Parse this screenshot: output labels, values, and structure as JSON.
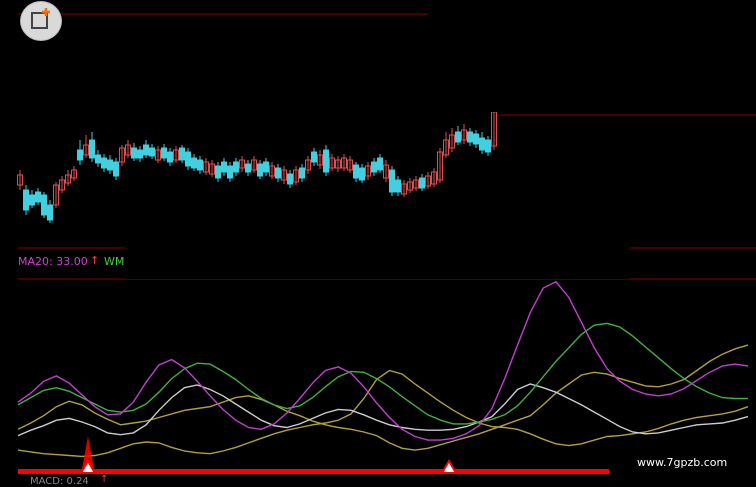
{
  "indicator_labels": {
    "ma20": "MA20: 33.00",
    "ma20_arrow": "↑",
    "next_series": "WM",
    "macd": "MACD: 0.24",
    "macd_arrow": "↑"
  },
  "watermark": "www.7gpzb.com",
  "logo": {
    "icon": "square-with-plus-icon",
    "accent": "#ff6a00"
  },
  "colors": {
    "background": "#000000",
    "up_candle": "#e05050",
    "down_candle": "#40d0e0",
    "grid_red": "#8b0000",
    "magenta": "#c040d0",
    "green": "#40b040",
    "white_line": "#cccccc",
    "yellow": "#b0a040",
    "signal_bar": "#ff0000",
    "label_magenta": "#d040d0",
    "label_green": "#40d040",
    "label_red": "#ff4040"
  },
  "chart_data": {
    "type": "line",
    "series": [
      {
        "values": [
          22,
          20,
          18,
          17,
          16,
          15,
          16,
          19,
          24,
          29,
          31,
          30,
          25,
          21,
          19,
          18,
          21,
          25,
          30,
          35,
          40,
          44,
          47,
          50,
          52,
          55,
          62,
          79,
          100,
          110,
          106,
          95,
          85,
          75,
          66,
          58,
          52,
          48,
          47,
          45,
          40,
          34,
          29,
          27,
          29,
          33,
          37,
          38,
          40,
          42,
          46,
          51,
          55,
          58,
          60,
          62,
          65,
          70
        ]
      },
      {
        "values": [
          38,
          44,
          49,
          55,
          57,
          53,
          48,
          41,
          39,
          41,
          50,
          66,
          80,
          91,
          94,
          89,
          82,
          73,
          64,
          55,
          49,
          47,
          51,
          57,
          63,
          67,
          66,
          61,
          55,
          50,
          47,
          45,
          44,
          44,
          45,
          48,
          53,
          59,
          73,
          89,
          95,
          91,
          86,
          79,
          72,
          64,
          56,
          48,
          42,
          40,
          41,
          44,
          47,
          50,
          51,
          52,
          55,
          59
        ]
      },
      {
        "values": [
          72,
          80,
          88,
          91,
          87,
          80,
          73,
          66,
          64,
          66,
          73,
          86,
          101,
          112,
          118,
          117,
          109,
          100,
          89,
          79,
          72,
          68,
          71,
          80,
          92,
          103,
          109,
          108,
          101,
          92,
          81,
          71,
          61,
          55,
          51,
          51,
          53,
          56,
          61,
          71,
          86,
          103,
          120,
          135,
          150,
          160,
          162,
          158,
          148,
          136,
          124,
          112,
          101,
          92,
          85,
          80,
          79,
          79
        ]
      },
      {
        "values": [
          75,
          85,
          98,
          104,
          96,
          83,
          70,
          61,
          62,
          75,
          97,
          116,
          122,
          113,
          98,
          82,
          67,
          55,
          47,
          45,
          51,
          63,
          79,
          96,
          110,
          114,
          107,
          92,
          74,
          58,
          45,
          37,
          33,
          33,
          35,
          40,
          49,
          68,
          101,
          138,
          174,
          201,
          208,
          191,
          163,
          135,
          112,
          98,
          89,
          84,
          82,
          84,
          90,
          99,
          108,
          115,
          117,
          115
        ]
      },
      {
        "values": [
          45,
          52,
          60,
          70,
          76,
          72,
          63,
          56,
          50,
          52,
          54,
          58,
          62,
          66,
          68,
          70,
          75,
          80,
          82,
          78,
          72,
          65,
          60,
          54,
          50,
          47,
          45,
          42,
          38,
          30,
          24,
          22,
          24,
          28,
          32,
          36,
          40,
          45,
          50,
          55,
          60,
          72,
          85,
          95,
          105,
          108,
          106,
          101,
          97,
          93,
          92,
          95,
          100,
          110,
          120,
          128,
          134,
          138
        ]
      }
    ]
  }
}
